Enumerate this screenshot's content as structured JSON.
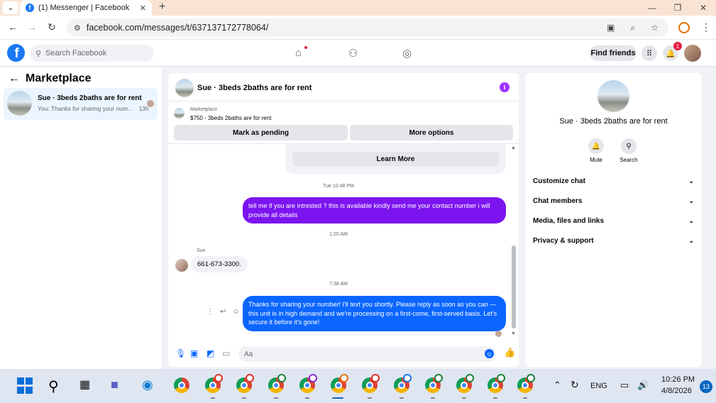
{
  "browser": {
    "tab_title": "(1) Messenger | Facebook",
    "url": "facebook.com/messages/t/637137172778064/"
  },
  "fb": {
    "search_placeholder": "Search Facebook",
    "find_friends": "Find friends",
    "notification_count": "1"
  },
  "sidebar": {
    "title": "Marketplace",
    "conversation": {
      "name": "Sue · 3beds 2baths are for rent",
      "snippet": "You: Thanks for sharing your num...",
      "time": "13h"
    }
  },
  "chat": {
    "title": "Sue · 3beds 2baths are for rent",
    "marketplace_label": "Marketplace",
    "listing": "$750 - 3beds 2baths are for rent",
    "mark_pending": "Mark as pending",
    "more_options": "More options",
    "learn_more": "Learn More",
    "messages": [
      {
        "timestamp": "Tue 10:48 PM",
        "text": "tell me if you are intrested ? this is available kindly send me your contact number i will provide all  details"
      },
      {
        "timestamp": "1:20 AM",
        "sender": "Sue",
        "text": "661-673-3300."
      },
      {
        "timestamp": "7:38 AM",
        "text": "Thanks for sharing your number! I'll text you shortly. Please reply as soon as you can — this unit is in high demand and we're processing on a first-come, first-served basis. Let's secure it before it's gone!"
      }
    ],
    "composer_placeholder": "Aa"
  },
  "details": {
    "name": "Sue · 3beds 2baths are for rent",
    "mute": "Mute",
    "search": "Search",
    "sections": [
      "Customize chat",
      "Chat members",
      "Media, files and links",
      "Privacy & support"
    ]
  },
  "taskbar": {
    "language": "ENG",
    "time": "10:26 PM",
    "date": "4/8/2026",
    "badge": "13"
  }
}
